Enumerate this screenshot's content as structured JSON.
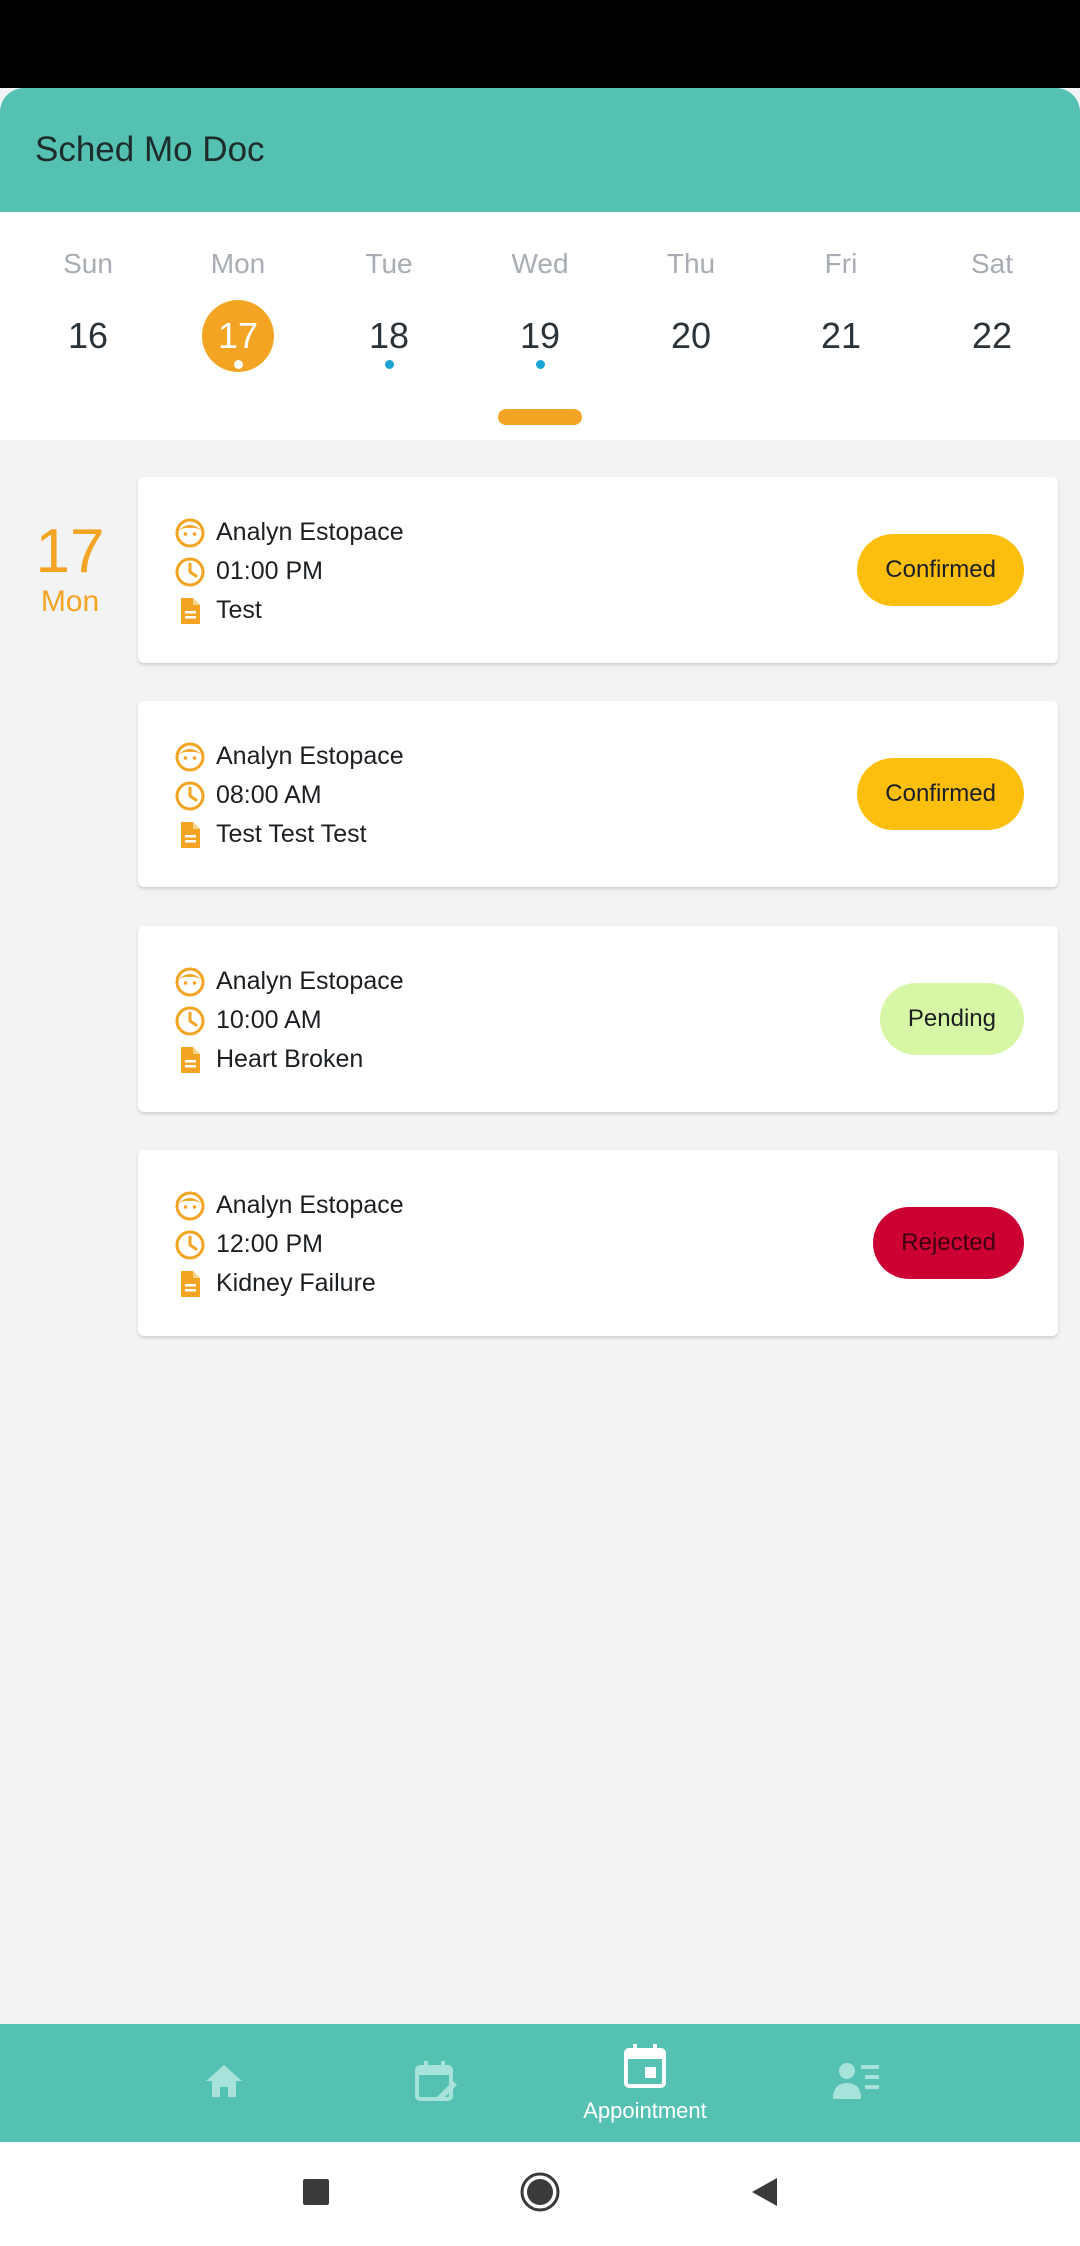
{
  "app": {
    "title": "Sched Mo Doc"
  },
  "week": {
    "days": [
      {
        "name": "Sun",
        "num": "16",
        "selected": false,
        "dot": false
      },
      {
        "name": "Mon",
        "num": "17",
        "selected": true,
        "dot": true
      },
      {
        "name": "Tue",
        "num": "18",
        "selected": false,
        "dot": true
      },
      {
        "name": "Wed",
        "num": "19",
        "selected": false,
        "dot": true
      },
      {
        "name": "Thu",
        "num": "20",
        "selected": false,
        "dot": false
      },
      {
        "name": "Fri",
        "num": "21",
        "selected": false,
        "dot": false
      },
      {
        "name": "Sat",
        "num": "22",
        "selected": false,
        "dot": false
      }
    ]
  },
  "agenda": {
    "date_num": "17",
    "date_dow": "Mon",
    "appointments": [
      {
        "patient": "Analyn Estopace",
        "time": "01:00 PM",
        "reason": "Test",
        "status": "Confirmed",
        "status_bg": "#fdbf0e",
        "status_fg": "#1b1f23"
      },
      {
        "patient": "Analyn Estopace",
        "time": "08:00 AM",
        "reason": "Test Test Test",
        "status": "Confirmed",
        "status_bg": "#fdbf0e",
        "status_fg": "#1b1f23"
      },
      {
        "patient": "Analyn Estopace",
        "time": "10:00 AM",
        "reason": "Heart Broken",
        "status": "Pending",
        "status_bg": "#d8f7a6",
        "status_fg": "#1b1f23"
      },
      {
        "patient": "Analyn Estopace",
        "time": "12:00 PM",
        "reason": "Kidney Failure",
        "status": "Rejected",
        "status_bg": "#cc0033",
        "status_fg": "#3a0010"
      }
    ]
  },
  "bottom_nav": {
    "items": [
      {
        "icon": "home-icon",
        "label": ""
      },
      {
        "icon": "calendar-edit-icon",
        "label": ""
      },
      {
        "icon": "calendar-icon",
        "label": "Appointment",
        "active": true
      },
      {
        "icon": "profile-list-icon",
        "label": ""
      }
    ]
  },
  "colors": {
    "accent": "#55c1b3",
    "orange": "#f4a423",
    "dot": "#1aa3d4"
  }
}
